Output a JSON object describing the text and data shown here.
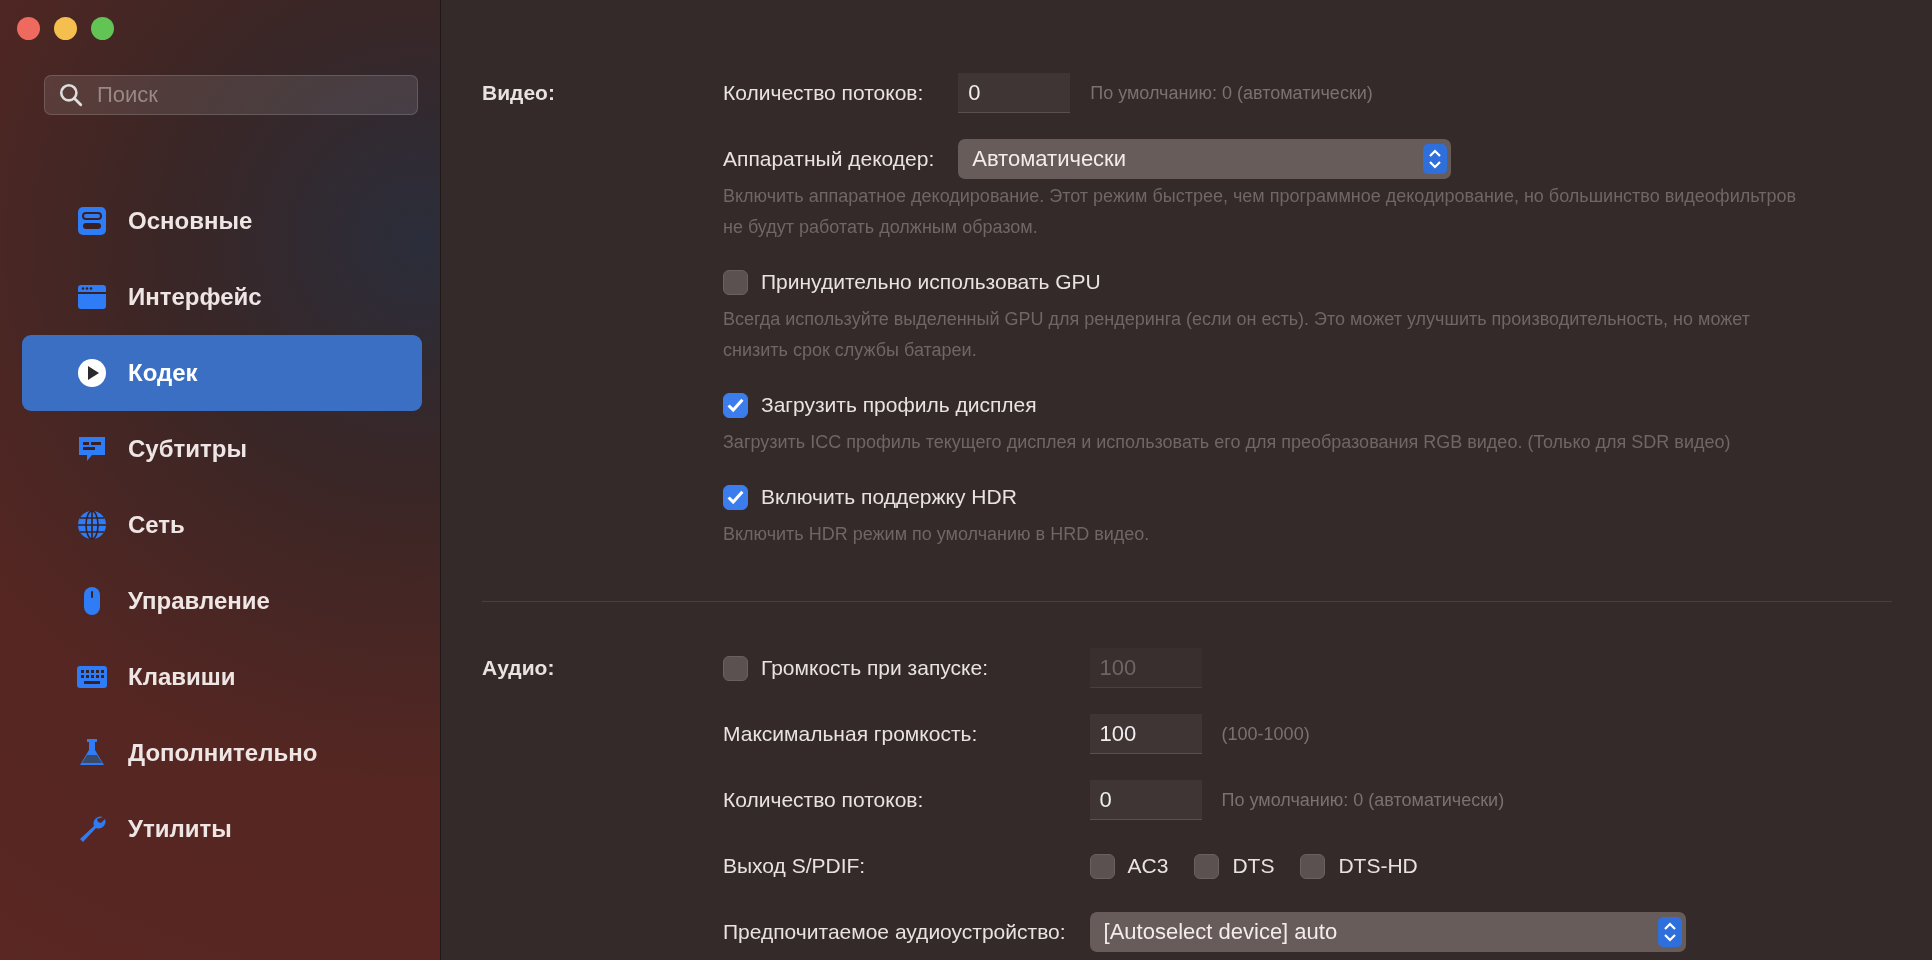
{
  "sidebar": {
    "search": {
      "placeholder": "Поиск"
    },
    "items": [
      {
        "label": "Основные",
        "selected": false
      },
      {
        "label": "Интерфейс",
        "selected": false
      },
      {
        "label": "Кодек",
        "selected": true
      },
      {
        "label": "Субтитры",
        "selected": false
      },
      {
        "label": "Сеть",
        "selected": false
      },
      {
        "label": "Управление",
        "selected": false
      },
      {
        "label": "Клавиши",
        "selected": false
      },
      {
        "label": "Дополнительно",
        "selected": false
      },
      {
        "label": "Утилиты",
        "selected": false
      }
    ]
  },
  "sections": [
    {
      "title": "Видео:",
      "rows": [
        {
          "kind": "field",
          "label": "Количество потоков:",
          "value": "0",
          "disabled": false,
          "hint": "По умолчанию: 0 (автоматически)"
        },
        {
          "kind": "select",
          "label": "Аппаратный декодер:",
          "value": "Автоматически",
          "description": "Включить аппаратное декодирование. Этот режим быстрее, чем программное декодирование, но большинство видеофильтров не будут работать должным образом."
        },
        {
          "kind": "checkbox",
          "label": "Принудительно использовать GPU",
          "checked": false,
          "description": "Всегда используйте выделенный GPU для рендеринга (если он есть). Это может улучшить производительность, но может снизить срок службы батареи."
        },
        {
          "kind": "checkbox",
          "label": "Загрузить профиль дисплея",
          "checked": true,
          "description": "Загрузить ICC профиль текущего дисплея и использовать его для преобразования RGB видео. (Только для SDR видео)"
        },
        {
          "kind": "checkbox",
          "label": "Включить поддержку HDR",
          "checked": true,
          "description": "Включить HDR режим по умолчанию в HRD видео."
        }
      ]
    },
    {
      "title": "Аудио:",
      "rows": [
        {
          "kind": "checkbox_field",
          "label": "Громкость при запуске:",
          "checked": false,
          "value": "100",
          "disabled": true
        },
        {
          "kind": "field",
          "label": "Максимальная громкость:",
          "value": "100",
          "disabled": false,
          "hint": "(100-1000)"
        },
        {
          "kind": "field",
          "label": "Количество потоков:",
          "value": "0",
          "disabled": false,
          "hint": "По умолчанию: 0 (автоматически)"
        },
        {
          "kind": "checkbox_group",
          "label": "Выход S/PDIF:",
          "options": [
            {
              "label": "AC3",
              "checked": false
            },
            {
              "label": "DTS",
              "checked": false
            },
            {
              "label": "DTS-HD",
              "checked": false
            }
          ]
        },
        {
          "kind": "select",
          "label": "Предпочитаемое аудиоустройство:",
          "value": "[Autoselect device] auto"
        }
      ]
    }
  ]
}
